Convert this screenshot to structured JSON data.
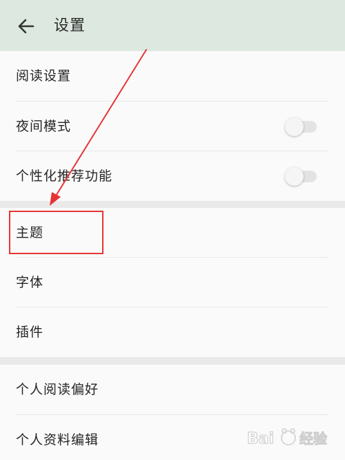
{
  "header": {
    "title": "设置",
    "back_icon": "arrow-left-icon"
  },
  "settings": {
    "section1": [
      {
        "label": "阅读设置"
      },
      {
        "label": "夜间模式",
        "toggle": false
      },
      {
        "label": "个性化推荐功能",
        "toggle": false
      }
    ],
    "section2": [
      {
        "label": "主题"
      },
      {
        "label": "字体"
      },
      {
        "label": "插件"
      }
    ],
    "section3": [
      {
        "label": "个人阅读偏好"
      },
      {
        "label": "个人资料编辑"
      }
    ]
  },
  "annotation": {
    "color": "#e63434",
    "highlighted_item": "主题"
  },
  "watermark": {
    "text": "Bai du 经验"
  },
  "colors": {
    "header_bg": "#dde9e0",
    "page_bg": "#fafafa",
    "section_gap": "#e9e9e9"
  }
}
